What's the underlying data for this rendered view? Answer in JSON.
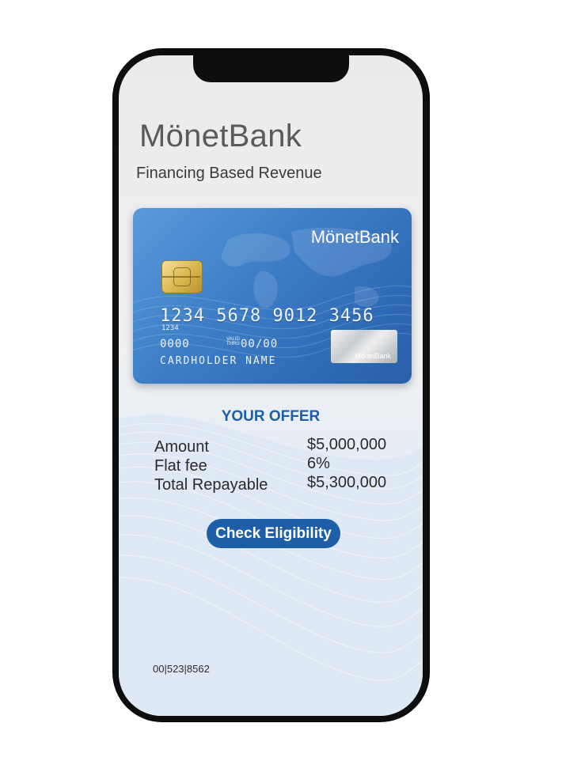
{
  "app": {
    "brand": "MönetBank",
    "subtitle": "Financing Based Revenue"
  },
  "card": {
    "brand": "MönetBank",
    "number": "1234 5678 9012 3456",
    "number_small": "1234",
    "code": "0000",
    "valid_label_top": "VALID",
    "valid_label_bottom": "THRU",
    "valid_thru": "00/00",
    "holder": "CARDHOLDER NAME",
    "hologram_text": "MönetBank"
  },
  "offer": {
    "title": "YOUR OFFER",
    "rows": [
      {
        "label": "Amount",
        "value": "$5,000,000"
      },
      {
        "label": "Flat fee",
        "value": "6%"
      },
      {
        "label": "Total Repayable",
        "value": "$5,300,000"
      }
    ],
    "button_label": "Check Eligibility"
  },
  "footer": {
    "reference": "00|523|8562"
  },
  "colors": {
    "accent": "#1e5ea6",
    "card_blue": "#3f7fc8",
    "title_gray": "#5a5a5a"
  }
}
